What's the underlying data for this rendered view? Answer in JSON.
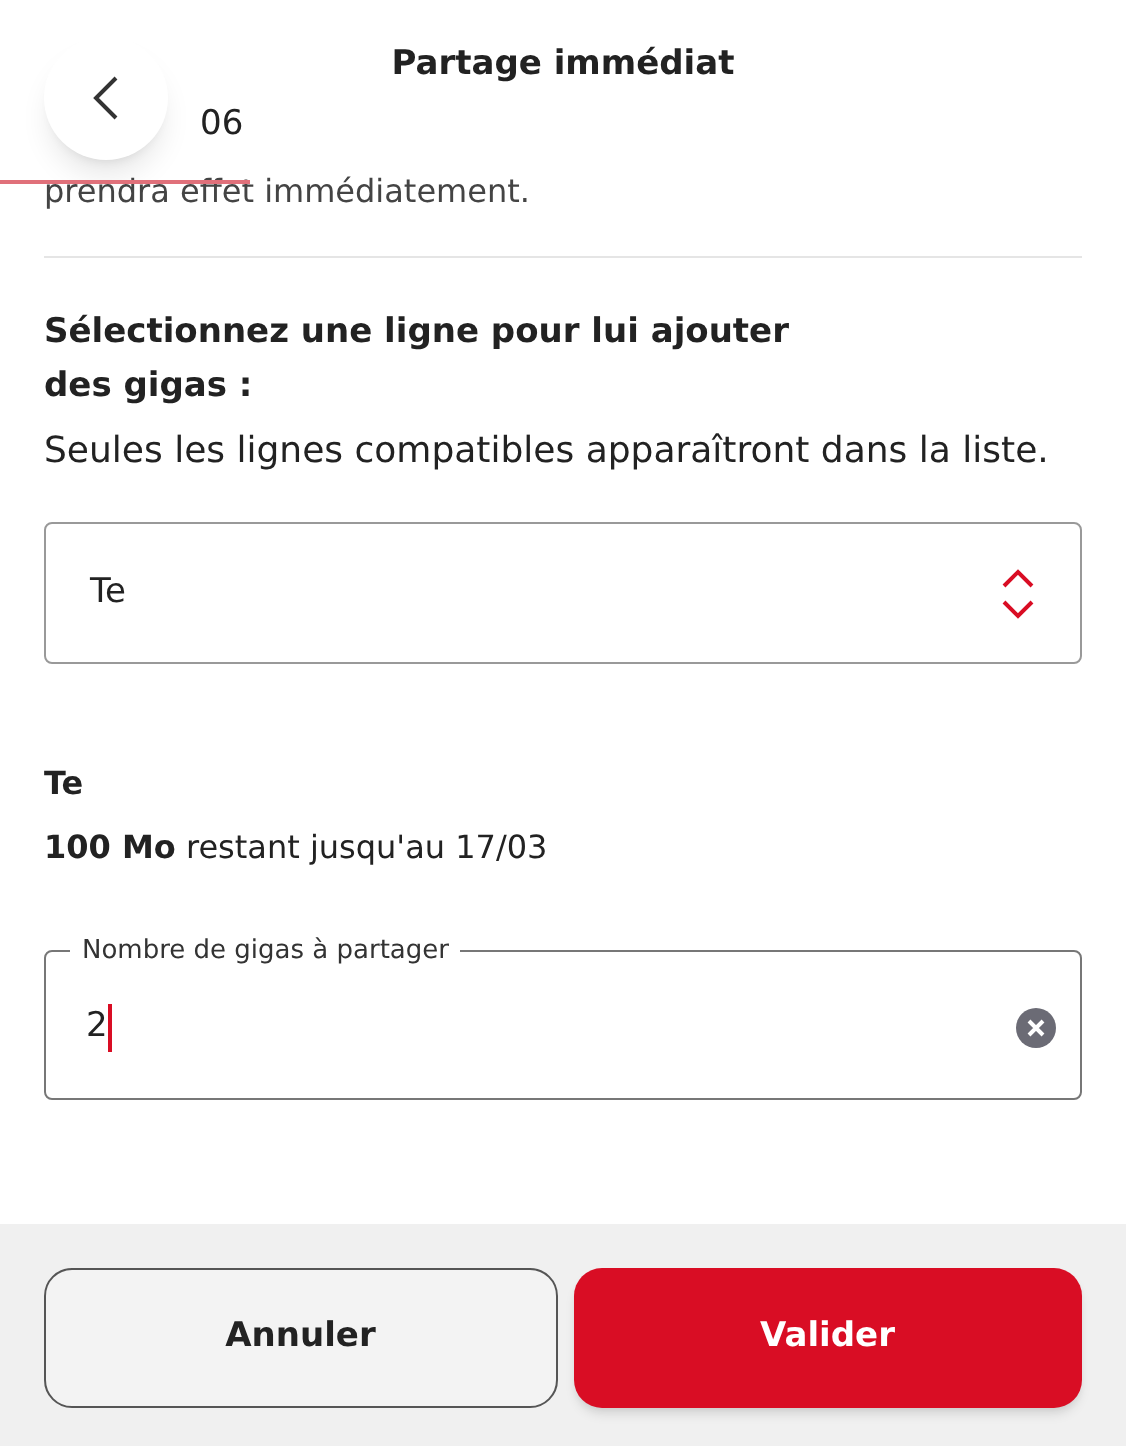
{
  "header": {
    "title": "Partage immédiat",
    "back_label": "06"
  },
  "intro_tail": "prendra effet immédiatement.",
  "section": {
    "heading": "Sélectionnez une ligne pour lui ajouter des gigas :",
    "hint": "Seules les lignes compatibles apparaîtront dans la liste."
  },
  "line_select": {
    "value": "Te"
  },
  "line_info": {
    "name": "Te",
    "remaining": "**100 Mo** restant jusqu'au 17/03"
  },
  "gigas_field": {
    "label": "Nombre de gigas à partager",
    "value": "2",
    "focused": true
  },
  "buttons": [
    {
      "label": "Annuler",
      "kind": "secondary"
    },
    {
      "label": "Valider",
      "kind": "primary"
    }
  ]
}
